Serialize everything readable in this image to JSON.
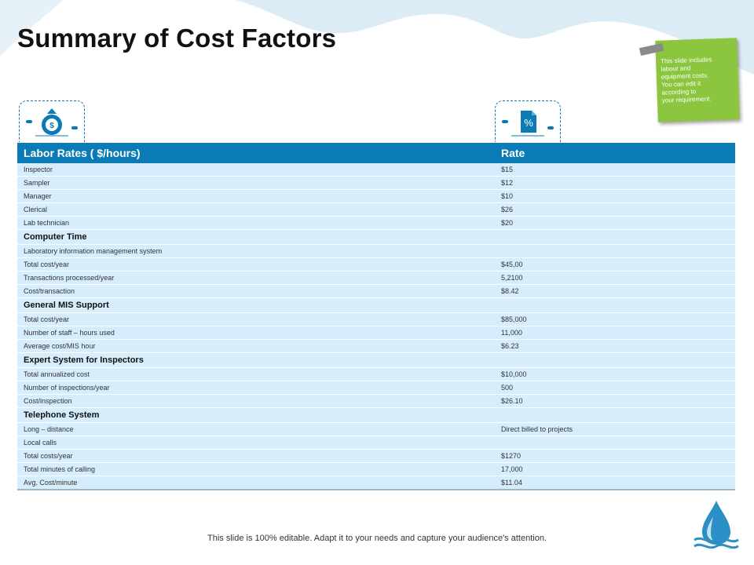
{
  "title": "Summary of Cost Factors",
  "sticky_note": "This slide includes\nlabour and\nequipment costs.\nYou can edit it\naccording to\n  your requirement.",
  "icons": [
    "money-bag-icon",
    "percent-document-icon"
  ],
  "table": {
    "headers": [
      "Labor Rates ( $/hours)",
      "Rate"
    ],
    "rows": [
      {
        "label": "Inspector",
        "value": "$15"
      },
      {
        "label": "Sampler",
        "value": "$12"
      },
      {
        "label": "Manager",
        "value": "$10"
      },
      {
        "label": "Clerical",
        "value": "$26"
      },
      {
        "label": "Lab technician",
        "value": "$20"
      },
      {
        "label": "Computer Time",
        "value": "",
        "section": true
      },
      {
        "label": "Laboratory information management  system",
        "value": ""
      },
      {
        "label": "Total cost/year",
        "value": "$45,00"
      },
      {
        "label": "Transactions processed/year",
        "value": "5,2100"
      },
      {
        "label": "Cost/transaction",
        "value": "$8.42"
      },
      {
        "label": "General MIS Support",
        "value": "",
        "section": true
      },
      {
        "label": "Total cost/year",
        "value": "$85,000"
      },
      {
        "label": "Number of staff – hours used",
        "value": "11,000"
      },
      {
        "label": "Average cost/MIS hour",
        "value": "$6.23"
      },
      {
        "label": "Expert System for Inspectors",
        "value": "",
        "section": true
      },
      {
        "label": "Total annualized cost",
        "value": "$10,000"
      },
      {
        "label": "Number of inspections/year",
        "value": "500"
      },
      {
        "label": "Cost/inspection",
        "value": "$26.10"
      },
      {
        "label": "Telephone System",
        "value": "",
        "section": true
      },
      {
        "label": "Long – distance",
        "value": "Direct billed to projects"
      },
      {
        "label": "Local calls",
        "value": ""
      },
      {
        "label": "Total costs/year",
        "value": "$1270"
      },
      {
        "label": "Total minutes of calling",
        "value": "17,000"
      },
      {
        "label": "Avg. Cost/minute",
        "value": "$11.04"
      }
    ]
  },
  "footer": "This slide is 100% editable. Adapt it to your needs and capture your audience's attention.",
  "colors": {
    "accent": "#0a7bb5",
    "row_bg": "#d6eefb",
    "sticky": "#8cc63f"
  }
}
